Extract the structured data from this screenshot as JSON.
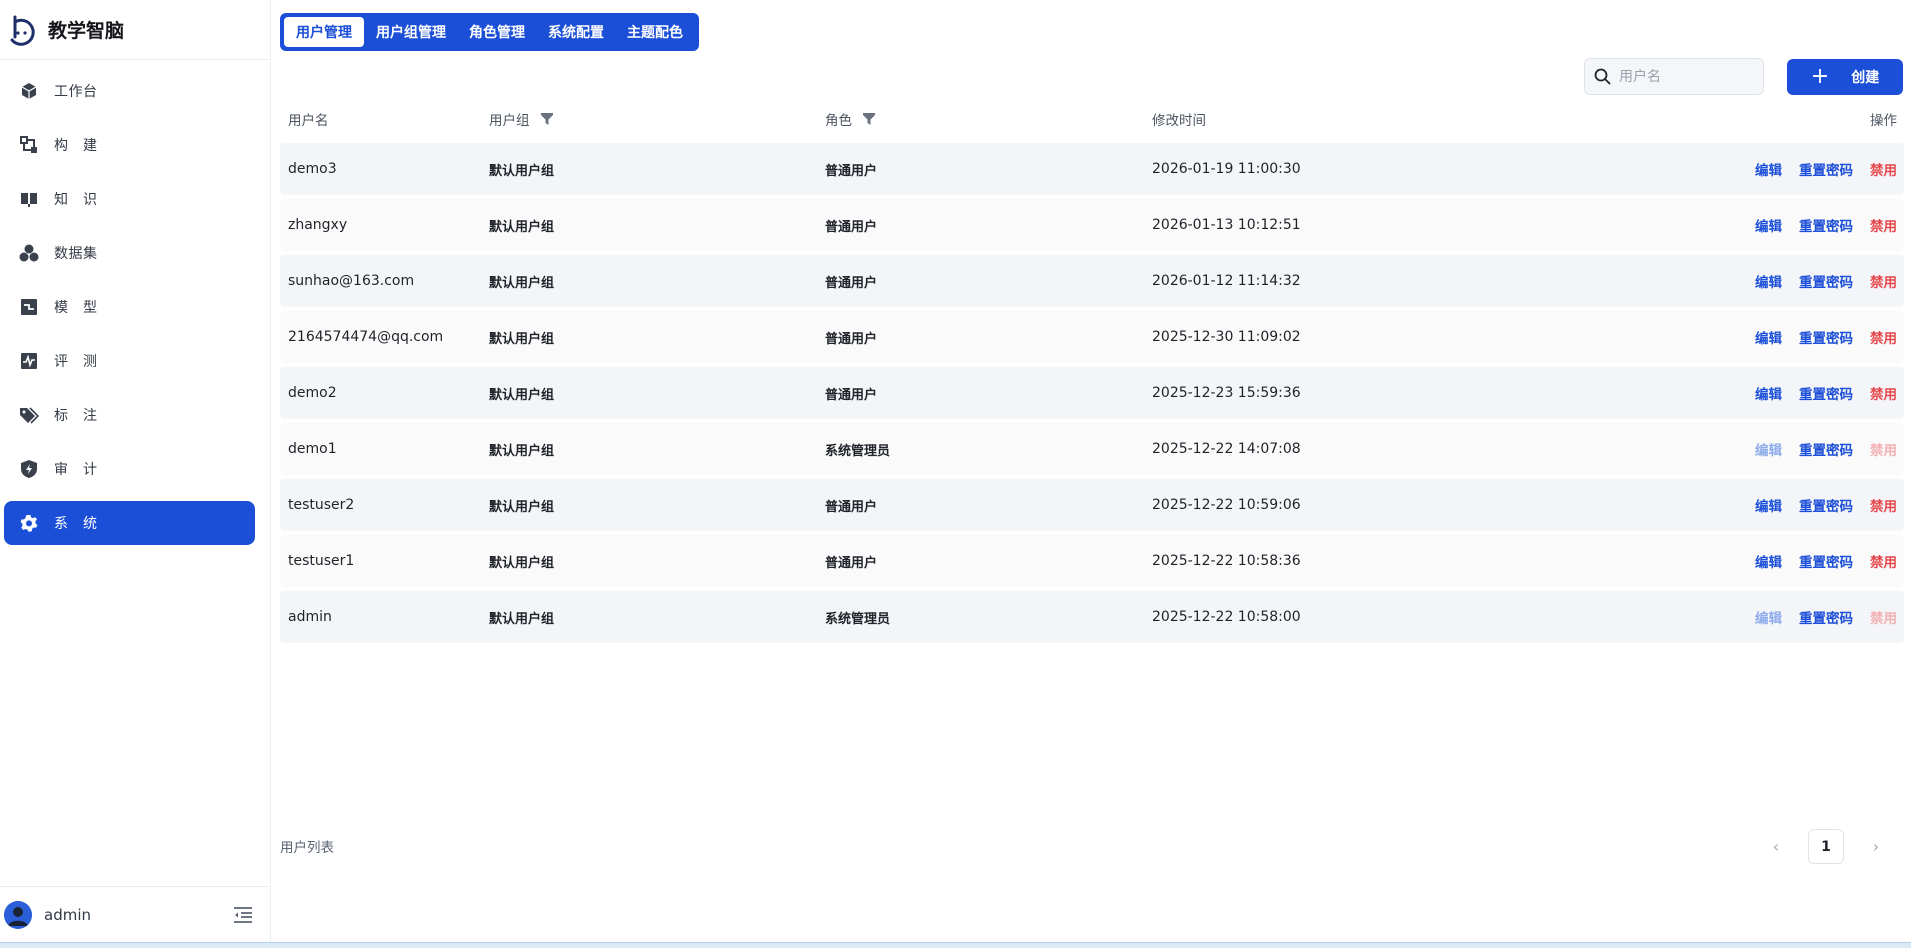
{
  "brand": {
    "name": "教学智脑",
    "logo_icon": "brain-logo-icon"
  },
  "sidebar": {
    "items": [
      {
        "label": "工作台",
        "icon": "cube-icon",
        "active": false
      },
      {
        "label": "构　建",
        "icon": "build-icon",
        "active": false
      },
      {
        "label": "知　识",
        "icon": "book-icon",
        "active": false
      },
      {
        "label": "数据集",
        "icon": "dataset-icon",
        "active": false
      },
      {
        "label": "模　型",
        "icon": "model-icon",
        "active": false
      },
      {
        "label": "评　测",
        "icon": "pulse-icon",
        "active": false
      },
      {
        "label": "标　注",
        "icon": "tag-icon",
        "active": false
      },
      {
        "label": "审　计",
        "icon": "shield-icon",
        "active": false
      },
      {
        "label": "系　统",
        "icon": "gear-icon",
        "active": true
      }
    ],
    "user": {
      "name": "admin"
    }
  },
  "tabs": [
    {
      "label": "用户管理",
      "active": true
    },
    {
      "label": "用户组管理",
      "active": false
    },
    {
      "label": "角色管理",
      "active": false
    },
    {
      "label": "系统配置",
      "active": false
    },
    {
      "label": "主题配色",
      "active": false
    }
  ],
  "search": {
    "placeholder": "用户名",
    "value": ""
  },
  "create_button": {
    "label": "创建"
  },
  "table": {
    "headers": {
      "username": "用户名",
      "group": "用户组",
      "role": "角色",
      "modified": "修改时间",
      "ops": "操作"
    },
    "ops_labels": {
      "edit": "编辑",
      "reset": "重置密码",
      "disable": "禁用"
    },
    "rows": [
      {
        "username": "demo3",
        "group": "默认用户组",
        "role": "普通用户",
        "modified": "2026-01-19 11:00:30",
        "ops_enabled": true
      },
      {
        "username": "zhangxy",
        "group": "默认用户组",
        "role": "普通用户",
        "modified": "2026-01-13 10:12:51",
        "ops_enabled": true
      },
      {
        "username": "sunhao@163.com",
        "group": "默认用户组",
        "role": "普通用户",
        "modified": "2026-01-12 11:14:32",
        "ops_enabled": true
      },
      {
        "username": "2164574474@qq.com",
        "group": "默认用户组",
        "role": "普通用户",
        "modified": "2025-12-30 11:09:02",
        "ops_enabled": true
      },
      {
        "username": "demo2",
        "group": "默认用户组",
        "role": "普通用户",
        "modified": "2025-12-23 15:59:36",
        "ops_enabled": true
      },
      {
        "username": "demo1",
        "group": "默认用户组",
        "role": "系统管理员",
        "modified": "2025-12-22 14:07:08",
        "ops_enabled": false
      },
      {
        "username": "testuser2",
        "group": "默认用户组",
        "role": "普通用户",
        "modified": "2025-12-22 10:59:06",
        "ops_enabled": true
      },
      {
        "username": "testuser1",
        "group": "默认用户组",
        "role": "普通用户",
        "modified": "2025-12-22 10:58:36",
        "ops_enabled": true
      },
      {
        "username": "admin",
        "group": "默认用户组",
        "role": "系统管理员",
        "modified": "2025-12-22 10:58:00",
        "ops_enabled": false
      }
    ]
  },
  "footer": {
    "caption": "用户列表",
    "current_page": "1"
  },
  "colors": {
    "accent": "#1c4fd8",
    "danger": "#e5484d",
    "row_bg": "#f4f5f8"
  }
}
